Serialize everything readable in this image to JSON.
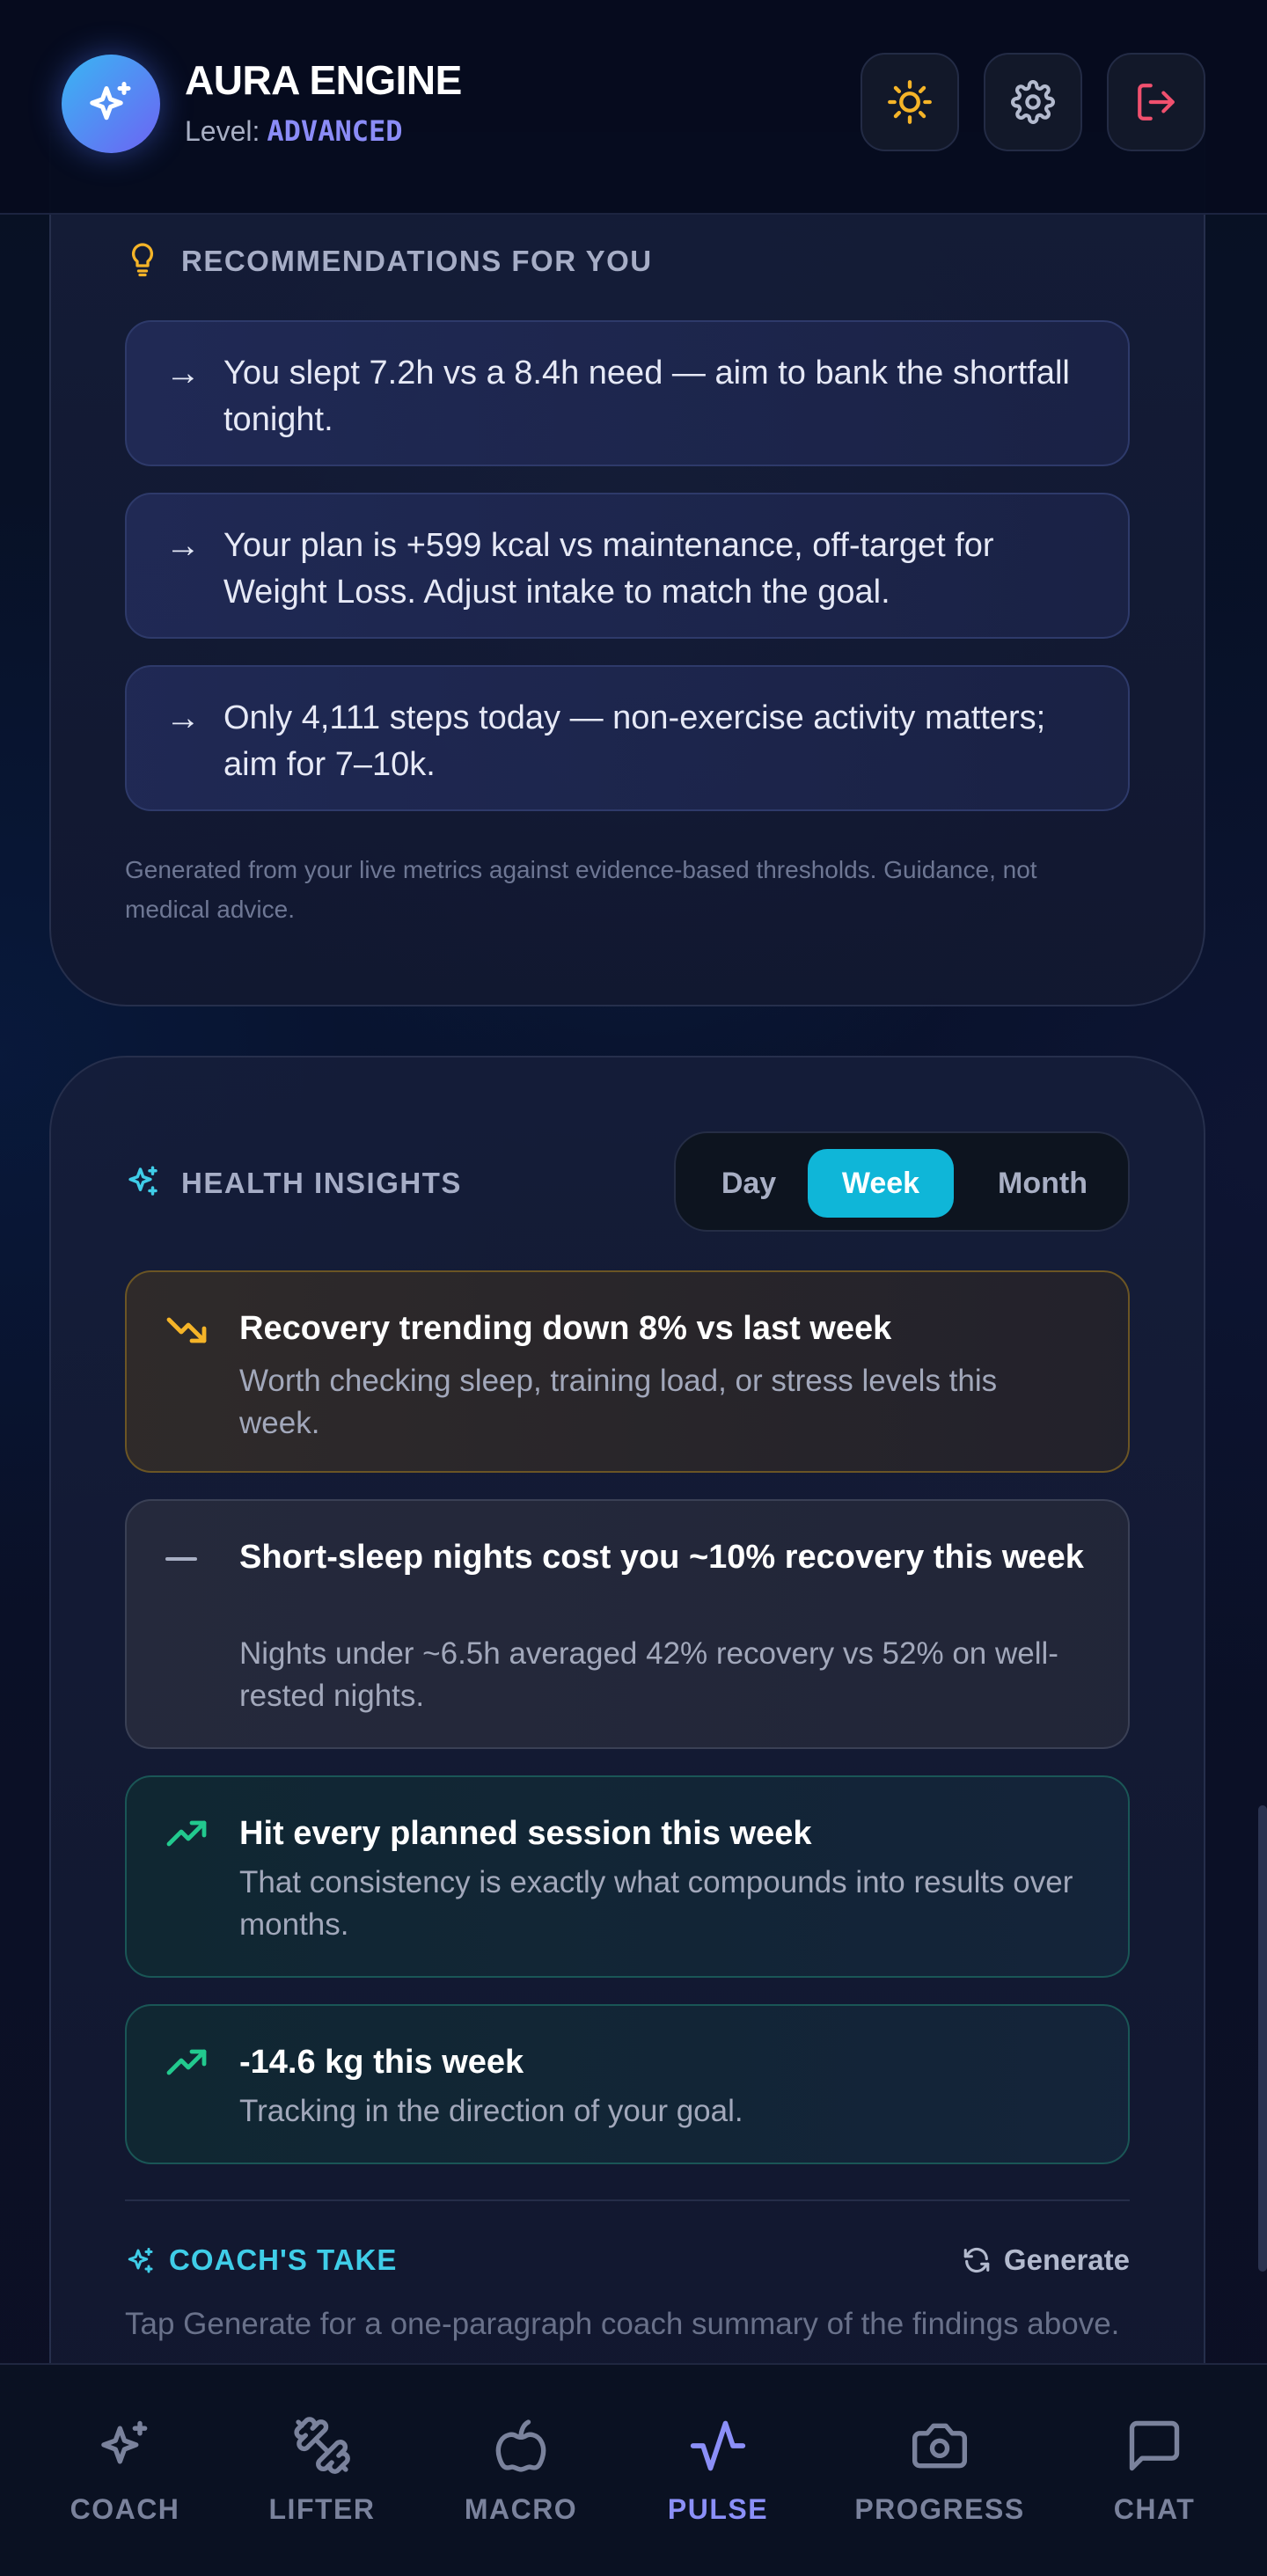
{
  "app": {
    "title": "AURA ENGINE",
    "level_label": "Level:",
    "level_value": "ADVANCED"
  },
  "header_buttons": [
    {
      "name": "theme-toggle",
      "icon": "sun-icon"
    },
    {
      "name": "settings",
      "icon": "gear-icon"
    },
    {
      "name": "logout",
      "icon": "logout-icon"
    }
  ],
  "recommendations": {
    "title": "RECOMMENDATIONS FOR YOU",
    "items": [
      {
        "arrow": "→",
        "text": "You slept 7.2h vs a 8.4h need — aim to bank the shortfall tonight."
      },
      {
        "arrow": "→",
        "text": "Your plan is +599 kcal vs maintenance, off-target for Weight Loss. Adjust intake to match the goal."
      },
      {
        "arrow": "→",
        "text": "Only 4,111 steps today — non-exercise activity matters; aim for 7–10k."
      }
    ],
    "disclaimer": "Generated from your live metrics against evidence-based thresholds. Guidance, not medical advice."
  },
  "insights": {
    "title": "HEALTH INSIGHTS",
    "periods": [
      "Day",
      "Week",
      "Month"
    ],
    "active_period": "Week",
    "items": [
      {
        "tone": "warning",
        "icon": "trending-down-icon",
        "title": "Recovery trending down 8% vs last week",
        "desc": "Worth checking sleep, training load, or stress levels this week."
      },
      {
        "tone": "neutral",
        "icon": "dash-icon",
        "title": "Short-sleep nights cost you ~10% recovery this week",
        "desc": "Nights under ~6.5h averaged 42% recovery vs 52% on well-rested nights."
      },
      {
        "tone": "positive",
        "icon": "trending-up-icon",
        "title": "Hit every planned session this week",
        "desc": "That consistency is exactly what compounds into results over months."
      },
      {
        "tone": "positive",
        "icon": "trending-up-icon",
        "title": "-14.6 kg this week",
        "desc": "Tracking in the direction of your goal."
      }
    ],
    "coach_take": {
      "title": "COACH'S TAKE",
      "generate_label": "Generate",
      "hint": "Tap Generate for a one-paragraph coach summary of the findings above."
    }
  },
  "nav": {
    "active": "PULSE",
    "items": [
      {
        "label": "COACH",
        "icon": "sparkle-icon"
      },
      {
        "label": "LIFTER",
        "icon": "dumbbell-icon"
      },
      {
        "label": "MACRO",
        "icon": "apple-icon"
      },
      {
        "label": "PULSE",
        "icon": "pulse-icon"
      },
      {
        "label": "PROGRESS",
        "icon": "camera-icon"
      },
      {
        "label": "CHAT",
        "icon": "chat-icon"
      }
    ]
  },
  "colors": {
    "accent_cyan": "#0fb6d8",
    "accent_violet": "#8b8ff8",
    "warning": "#f5b428",
    "positive": "#22c98e",
    "danger": "#f0506e"
  }
}
